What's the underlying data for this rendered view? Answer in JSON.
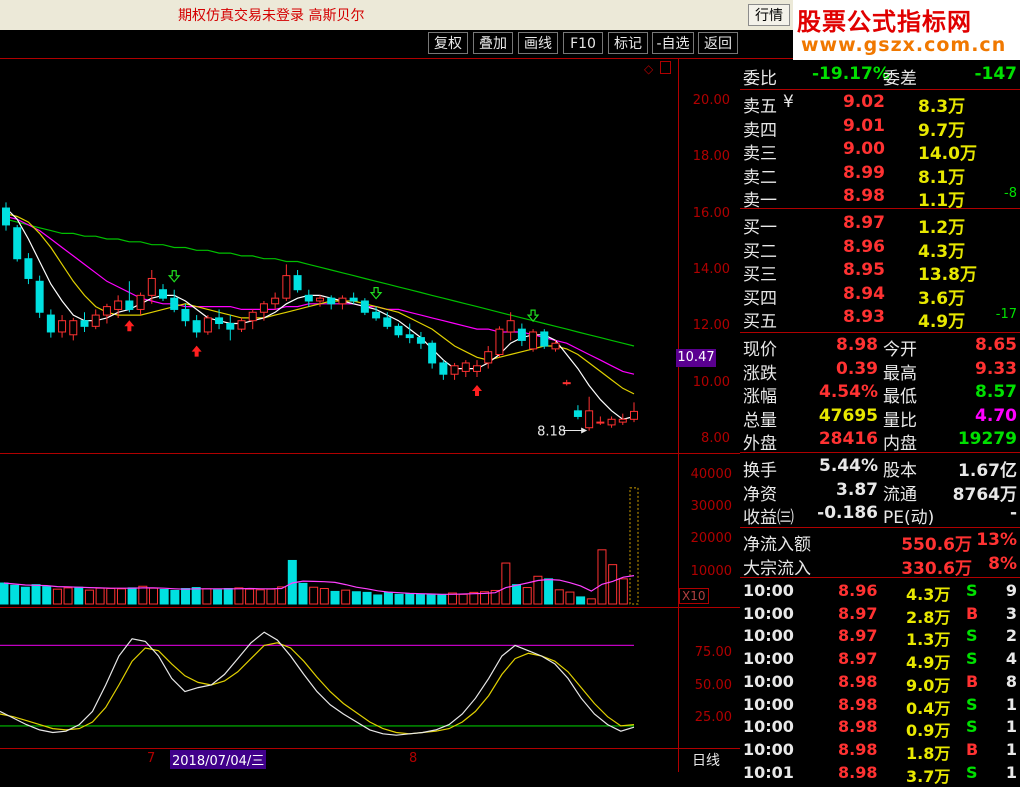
{
  "top": {
    "login_status": "期权仿真交易未登录  高斯贝尔",
    "quote_button": "行情",
    "logo_line1": "股票公式指标网",
    "logo_line2": "www.gszx.com.cn"
  },
  "toolbar": {
    "buttons": [
      "复权",
      "叠加",
      "画线",
      "F10",
      "标记",
      "-自选",
      "返回"
    ]
  },
  "chart": {
    "price_axis": [
      "20.00",
      "18.00",
      "16.00",
      "14.00",
      "12.00",
      "10.00",
      "8.00"
    ],
    "current_price_tag": "10.47",
    "low_marker": "8.18",
    "volume_axis": [
      "40000",
      "30000",
      "20000",
      "10000"
    ],
    "volume_unit": "X10",
    "kdj_axis": [
      "75.00",
      "50.00",
      "25.00"
    ],
    "date_label": "2018/07/04/三",
    "month_marks": [
      "7",
      "8"
    ],
    "period": "日线",
    "colors": {
      "up": "#ff3232",
      "down": "#00e0e0",
      "ma5": "#ffffff",
      "ma10": "#e0d000",
      "ma20": "#ff00ff",
      "ma60": "#00c000"
    }
  },
  "chart_data": {
    "type": "candlestick",
    "candles": [
      {
        "o": 16.2,
        "h": 16.4,
        "l": 15.4,
        "c": 15.6
      },
      {
        "o": 15.5,
        "h": 15.6,
        "l": 14.3,
        "c": 14.4
      },
      {
        "o": 14.4,
        "h": 14.6,
        "l": 13.5,
        "c": 13.7
      },
      {
        "o": 13.6,
        "h": 13.8,
        "l": 12.3,
        "c": 12.5
      },
      {
        "o": 12.4,
        "h": 12.6,
        "l": 11.6,
        "c": 11.8
      },
      {
        "o": 11.8,
        "h": 12.4,
        "l": 11.6,
        "c": 12.2
      },
      {
        "o": 11.7,
        "h": 12.3,
        "l": 11.5,
        "c": 12.2
      },
      {
        "o": 12.2,
        "h": 12.5,
        "l": 11.8,
        "c": 12.0
      },
      {
        "o": 12.0,
        "h": 12.6,
        "l": 11.9,
        "c": 12.4
      },
      {
        "o": 12.4,
        "h": 12.8,
        "l": 12.1,
        "c": 12.7
      },
      {
        "o": 12.6,
        "h": 13.1,
        "l": 12.3,
        "c": 12.9
      },
      {
        "o": 12.9,
        "h": 13.6,
        "l": 12.5,
        "c": 12.6
      },
      {
        "o": 12.6,
        "h": 13.2,
        "l": 12.4,
        "c": 13.1
      },
      {
        "o": 13.1,
        "h": 14.0,
        "l": 12.8,
        "c": 13.7
      },
      {
        "o": 13.3,
        "h": 13.5,
        "l": 12.9,
        "c": 13.0
      },
      {
        "o": 13.0,
        "h": 13.3,
        "l": 12.5,
        "c": 12.6
      },
      {
        "o": 12.6,
        "h": 12.8,
        "l": 12.0,
        "c": 12.2
      },
      {
        "o": 12.2,
        "h": 12.4,
        "l": 11.6,
        "c": 11.8
      },
      {
        "o": 11.8,
        "h": 12.4,
        "l": 11.7,
        "c": 12.3
      },
      {
        "o": 12.3,
        "h": 12.6,
        "l": 11.9,
        "c": 12.1
      },
      {
        "o": 12.1,
        "h": 12.4,
        "l": 11.5,
        "c": 11.9
      },
      {
        "o": 11.9,
        "h": 12.3,
        "l": 11.8,
        "c": 12.2
      },
      {
        "o": 12.2,
        "h": 12.6,
        "l": 11.9,
        "c": 12.5
      },
      {
        "o": 12.5,
        "h": 12.9,
        "l": 12.2,
        "c": 12.8
      },
      {
        "o": 12.8,
        "h": 13.2,
        "l": 12.6,
        "c": 13.0
      },
      {
        "o": 13.0,
        "h": 14.2,
        "l": 12.9,
        "c": 13.8
      },
      {
        "o": 13.8,
        "h": 14.0,
        "l": 13.2,
        "c": 13.3
      },
      {
        "o": 13.1,
        "h": 13.3,
        "l": 12.7,
        "c": 12.9
      },
      {
        "o": 12.9,
        "h": 13.1,
        "l": 12.7,
        "c": 13.0
      },
      {
        "o": 13.0,
        "h": 13.1,
        "l": 12.6,
        "c": 12.8
      },
      {
        "o": 12.8,
        "h": 13.1,
        "l": 12.6,
        "c": 13.0
      },
      {
        "o": 13.0,
        "h": 13.2,
        "l": 12.8,
        "c": 12.9
      },
      {
        "o": 12.9,
        "h": 13.0,
        "l": 12.4,
        "c": 12.5
      },
      {
        "o": 12.5,
        "h": 12.7,
        "l": 12.2,
        "c": 12.3
      },
      {
        "o": 12.3,
        "h": 12.5,
        "l": 11.9,
        "c": 12.0
      },
      {
        "o": 12.0,
        "h": 12.1,
        "l": 11.6,
        "c": 11.7
      },
      {
        "o": 11.7,
        "h": 12.1,
        "l": 11.4,
        "c": 11.6
      },
      {
        "o": 11.6,
        "h": 11.8,
        "l": 11.2,
        "c": 11.4
      },
      {
        "o": 11.4,
        "h": 11.5,
        "l": 10.5,
        "c": 10.7
      },
      {
        "o": 10.7,
        "h": 10.8,
        "l": 10.1,
        "c": 10.3
      },
      {
        "o": 10.3,
        "h": 10.7,
        "l": 10.1,
        "c": 10.6
      },
      {
        "o": 10.4,
        "h": 10.8,
        "l": 10.2,
        "c": 10.7
      },
      {
        "o": 10.4,
        "h": 10.8,
        "l": 10.2,
        "c": 10.6
      },
      {
        "o": 10.7,
        "h": 11.3,
        "l": 10.5,
        "c": 11.1
      },
      {
        "o": 11.0,
        "h": 12.0,
        "l": 10.9,
        "c": 11.9
      },
      {
        "o": 11.8,
        "h": 12.5,
        "l": 11.5,
        "c": 12.2
      },
      {
        "o": 11.9,
        "h": 12.1,
        "l": 11.3,
        "c": 11.5
      },
      {
        "o": 11.2,
        "h": 11.9,
        "l": 11.1,
        "c": 11.8
      },
      {
        "o": 11.8,
        "h": 11.9,
        "l": 11.2,
        "c": 11.3
      },
      {
        "o": 11.2,
        "h": 11.5,
        "l": 11.1,
        "c": 11.4
      },
      {
        "o": 10.0,
        "h": 10.1,
        "l": 9.9,
        "c": 10.0
      },
      {
        "o": 9.0,
        "h": 9.2,
        "l": 8.7,
        "c": 8.8
      },
      {
        "o": 8.4,
        "h": 9.5,
        "l": 8.3,
        "c": 9.0
      },
      {
        "o": 8.6,
        "h": 8.8,
        "l": 8.5,
        "c": 8.6
      },
      {
        "o": 8.5,
        "h": 8.8,
        "l": 8.4,
        "c": 8.7
      },
      {
        "o": 8.6,
        "h": 8.9,
        "l": 8.5,
        "c": 8.7
      },
      {
        "o": 8.7,
        "h": 9.3,
        "l": 8.6,
        "c": 8.98
      }
    ],
    "ma5": [
      16.2,
      15.8,
      15.1,
      14.3,
      13.5,
      12.9,
      12.4,
      12.2,
      12.2,
      12.3,
      12.5,
      12.6,
      12.8,
      13.0,
      13.1,
      13.1,
      12.9,
      12.6,
      12.3,
      12.2,
      12.1,
      12.1,
      12.2,
      12.3,
      12.5,
      12.8,
      13.0,
      13.1,
      13.1,
      13.0,
      12.9,
      12.8,
      12.7,
      12.6,
      12.4,
      12.2,
      11.9,
      11.6,
      11.2,
      10.8,
      10.5,
      10.5,
      10.5,
      10.7,
      11.0,
      11.4,
      11.6,
      11.7,
      11.7,
      11.5,
      11.0,
      10.5,
      9.9,
      9.4,
      9.0,
      8.7,
      8.8
    ],
    "ma10": [
      16.0,
      15.9,
      15.7,
      15.3,
      14.8,
      14.2,
      13.6,
      13.1,
      12.7,
      12.5,
      12.4,
      12.4,
      12.4,
      12.5,
      12.6,
      12.7,
      12.8,
      12.7,
      12.6,
      12.5,
      12.4,
      12.3,
      12.3,
      12.3,
      12.4,
      12.5,
      12.6,
      12.7,
      12.8,
      12.9,
      12.9,
      12.9,
      12.8,
      12.7,
      12.6,
      12.5,
      12.3,
      12.1,
      11.9,
      11.6,
      11.3,
      11.1,
      10.9,
      10.8,
      10.9,
      11.0,
      11.1,
      11.2,
      11.3,
      11.3,
      11.2,
      11.0,
      10.7,
      10.4,
      10.1,
      9.8,
      9.6
    ],
    "ma20": [
      15.9,
      15.8,
      15.6,
      15.4,
      15.1,
      14.8,
      14.5,
      14.2,
      13.9,
      13.6,
      13.4,
      13.2,
      13.0,
      12.9,
      12.8,
      12.8,
      12.7,
      12.7,
      12.7,
      12.7,
      12.7,
      12.6,
      12.6,
      12.6,
      12.6,
      12.7,
      12.7,
      12.8,
      12.8,
      12.8,
      12.8,
      12.8,
      12.7,
      12.7,
      12.6,
      12.6,
      12.5,
      12.4,
      12.3,
      12.2,
      12.1,
      12.0,
      11.9,
      11.9,
      11.8,
      11.8,
      11.8,
      11.7,
      11.6,
      11.5,
      11.4,
      11.2,
      11.0,
      10.8,
      10.6,
      10.4,
      10.3
    ],
    "ma60": [
      15.8,
      15.7,
      15.6,
      15.5,
      15.4,
      15.3,
      15.3,
      15.2,
      15.2,
      15.1,
      15.1,
      15.0,
      15.0,
      14.9,
      14.9,
      14.8,
      14.8,
      14.7,
      14.7,
      14.6,
      14.6,
      14.5,
      14.5,
      14.4,
      14.4,
      14.3,
      14.3,
      14.2,
      14.1,
      14.0,
      13.9,
      13.8,
      13.7,
      13.6,
      13.5,
      13.4,
      13.3,
      13.2,
      13.1,
      13.0,
      12.9,
      12.8,
      12.7,
      12.6,
      12.5,
      12.4,
      12.3,
      12.2,
      12.1,
      12.0,
      11.9,
      11.8,
      11.7,
      11.6,
      11.5,
      11.4,
      11.3
    ],
    "volume": [
      6500,
      5800,
      5200,
      6000,
      5400,
      4600,
      5000,
      5200,
      4300,
      4900,
      4800,
      4700,
      5000,
      5500,
      4900,
      4500,
      4200,
      4800,
      5100,
      4700,
      4400,
      4800,
      5000,
      4600,
      4400,
      4600,
      5300,
      13500,
      6400,
      5200,
      4800,
      3900,
      4300,
      3800,
      3600,
      2800,
      3600,
      3000,
      3200,
      3000,
      2900,
      2800,
      3400,
      3000,
      3600,
      3800,
      4200,
      12700,
      6000,
      5100,
      8600,
      7800,
      4400,
      3700,
      2200,
      1600,
      16800,
      12200,
      7800,
      36000
    ],
    "volume_ma": [
      6500,
      6200,
      5900,
      5800,
      5700,
      5400,
      5300,
      5200,
      5100,
      5000,
      4900,
      4900,
      4900,
      5000,
      5000,
      4900,
      4700,
      4600,
      4700,
      4700,
      4700,
      4700,
      4700,
      4800,
      4700,
      4700,
      4800,
      6500,
      7100,
      7000,
      6900,
      6700,
      6000,
      5200,
      4700,
      4100,
      3700,
      3500,
      3300,
      3200,
      3100,
      3000,
      3000,
      3100,
      3200,
      3300,
      3500,
      5100,
      5800,
      6500,
      7300,
      7600,
      7400,
      6600,
      5600,
      4000,
      6100,
      7000,
      8300,
      8800
    ],
    "kdj_k": [
      30,
      25,
      20,
      16,
      14,
      15,
      20,
      30,
      50,
      72,
      85,
      83,
      72,
      55,
      45,
      48,
      50,
      58,
      70,
      82,
      90,
      84,
      72,
      58,
      45,
      35,
      28,
      22,
      16,
      13,
      12,
      13,
      14,
      16,
      20,
      28,
      40,
      55,
      72,
      80,
      76,
      72,
      66,
      55,
      40,
      28,
      20,
      15,
      18
    ],
    "kdj_d": [
      28,
      26,
      23,
      20,
      17,
      16,
      17,
      22,
      33,
      50,
      68,
      78,
      76,
      66,
      57,
      52,
      50,
      53,
      60,
      70,
      80,
      82,
      78,
      68,
      56,
      45,
      36,
      29,
      22,
      17,
      14,
      13,
      14,
      15,
      17,
      22,
      30,
      42,
      58,
      70,
      74,
      72,
      68,
      60,
      48,
      36,
      26,
      19,
      20
    ],
    "kdj_level_high": 80,
    "kdj_level_low": 19,
    "ylim_price": [
      7.5,
      21.0
    ],
    "ylim_volume": [
      0,
      44000
    ],
    "ylim_kdj": [
      0,
      110
    ]
  },
  "quote": {
    "weibi_label": "委比",
    "weibi_value": "-19.17%",
    "weicha_label": "委差",
    "weicha_value": "-147",
    "asks": [
      {
        "label": "卖五",
        "mark": "¥",
        "price": "9.02",
        "vol": "8.3万",
        "chg": ""
      },
      {
        "label": "卖四",
        "mark": "",
        "price": "9.01",
        "vol": "9.7万",
        "chg": ""
      },
      {
        "label": "卖三",
        "mark": "",
        "price": "9.00",
        "vol": "14.0万",
        "chg": ""
      },
      {
        "label": "卖二",
        "mark": "",
        "price": "8.99",
        "vol": "8.1万",
        "chg": ""
      },
      {
        "label": "卖一",
        "mark": "",
        "price": "8.98",
        "vol": "1.1万",
        "chg": "-8"
      }
    ],
    "bids": [
      {
        "label": "买一",
        "price": "8.97",
        "vol": "1.2万",
        "chg": ""
      },
      {
        "label": "买二",
        "price": "8.96",
        "vol": "4.3万",
        "chg": ""
      },
      {
        "label": "买三",
        "price": "8.95",
        "vol": "13.8万",
        "chg": ""
      },
      {
        "label": "买四",
        "price": "8.94",
        "vol": "3.6万",
        "chg": ""
      },
      {
        "label": "买五",
        "price": "8.93",
        "vol": "4.9万",
        "chg": "-17"
      }
    ],
    "stats": [
      {
        "l1": "现价",
        "v1": "8.98",
        "c1": "red",
        "l2": "今开",
        "v2": "8.65",
        "c2": "red"
      },
      {
        "l1": "涨跌",
        "v1": "0.39",
        "c1": "red",
        "l2": "最高",
        "v2": "9.33",
        "c2": "red"
      },
      {
        "l1": "涨幅",
        "v1": "4.54%",
        "c1": "red",
        "l2": "最低",
        "v2": "8.57",
        "c2": "green"
      },
      {
        "l1": "总量",
        "v1": "47695",
        "c1": "yellow",
        "l2": "量比",
        "v2": "4.70",
        "c2": "mag"
      },
      {
        "l1": "外盘",
        "v1": "28416",
        "c1": "red",
        "l2": "内盘",
        "v2": "19279",
        "c2": "green"
      }
    ],
    "info": [
      {
        "l1": "换手",
        "v1": "5.44%",
        "l2": "股本",
        "v2": "1.67亿"
      },
      {
        "l1": "净资",
        "v1": "3.87",
        "l2": "流通",
        "v2": "8764万"
      },
      {
        "l1": "收益㈢",
        "v1": "-0.186",
        "l2": "PE(动)",
        "v2": "-"
      }
    ],
    "flows": [
      {
        "label": "净流入额",
        "value": "550.6万",
        "pct": "13%"
      },
      {
        "label": "大宗流入",
        "value": "330.6万",
        "pct": "8%"
      }
    ],
    "ticks": [
      {
        "time": "10:00",
        "price": "8.96",
        "vol": "4.3万",
        "side": "S",
        "n": "9"
      },
      {
        "time": "10:00",
        "price": "8.97",
        "vol": "2.8万",
        "side": "B",
        "n": "3"
      },
      {
        "time": "10:00",
        "price": "8.97",
        "vol": "1.3万",
        "side": "S",
        "n": "2"
      },
      {
        "time": "10:00",
        "price": "8.97",
        "vol": "4.9万",
        "side": "S",
        "n": "4"
      },
      {
        "time": "10:00",
        "price": "8.98",
        "vol": "9.0万",
        "side": "B",
        "n": "8"
      },
      {
        "time": "10:00",
        "price": "8.98",
        "vol": "0.4万",
        "side": "S",
        "n": "1"
      },
      {
        "time": "10:00",
        "price": "8.98",
        "vol": "0.9万",
        "side": "S",
        "n": "1"
      },
      {
        "time": "10:00",
        "price": "8.98",
        "vol": "1.8万",
        "side": "B",
        "n": "1"
      },
      {
        "time": "10:01",
        "price": "8.98",
        "vol": "3.7万",
        "side": "S",
        "n": "1"
      }
    ]
  }
}
